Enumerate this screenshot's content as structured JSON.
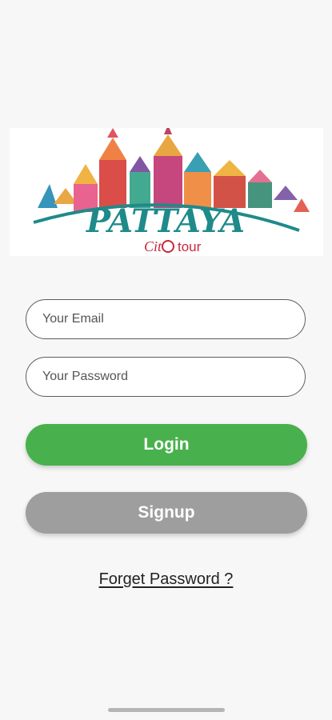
{
  "logo": {
    "title": "PATTAYA",
    "subtitle_prefix": "Cit",
    "subtitle_suffix": "tour",
    "colors": {
      "brand_teal": "#1f8a8a",
      "accent_red": "#c6283a"
    }
  },
  "form": {
    "email_placeholder": "Your Email",
    "password_placeholder": "Your Password",
    "email_value": "",
    "password_value": ""
  },
  "actions": {
    "login_label": "Login",
    "signup_label": "Signup",
    "forget_label": "Forget Password ?"
  },
  "colors": {
    "login": "#48b14d",
    "signup": "#9e9e9e",
    "background": "#f7f7f7"
  }
}
